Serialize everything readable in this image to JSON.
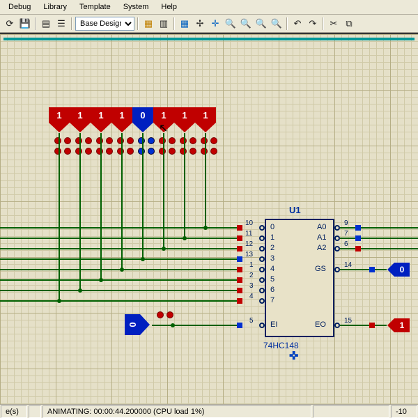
{
  "menu": {
    "items": [
      "Debug",
      "Library",
      "Template",
      "System",
      "Help"
    ]
  },
  "toolbar": {
    "design_dropdown": "Base Design"
  },
  "logic_inputs": {
    "top_row": [
      {
        "value": "1",
        "color": "red"
      },
      {
        "value": "1",
        "color": "red"
      },
      {
        "value": "1",
        "color": "red"
      },
      {
        "value": "1",
        "color": "red"
      },
      {
        "value": "0",
        "color": "blue"
      },
      {
        "value": "1",
        "color": "red"
      },
      {
        "value": "1",
        "color": "red"
      },
      {
        "value": "1",
        "color": "red"
      }
    ],
    "ei": {
      "value": "0",
      "color": "blue"
    }
  },
  "chip": {
    "ref": "U1",
    "part": "74HC148",
    "left_pins": [
      {
        "num": "10",
        "label": "0"
      },
      {
        "num": "11",
        "label": "1"
      },
      {
        "num": "12",
        "label": "2"
      },
      {
        "num": "13",
        "label": "3"
      },
      {
        "num": "1",
        "label": "4"
      },
      {
        "num": "2",
        "label": "5"
      },
      {
        "num": "3",
        "label": "6"
      },
      {
        "num": "4",
        "label": "7"
      },
      {
        "num": "5",
        "label": "EI"
      }
    ],
    "right_pins": [
      {
        "num": "9",
        "label": "A0"
      },
      {
        "num": "7",
        "label": "A1"
      },
      {
        "num": "6",
        "label": "A2"
      },
      {
        "num": "14",
        "label": "GS"
      },
      {
        "num": "15",
        "label": "EO"
      }
    ]
  },
  "outputs": {
    "gs": {
      "value": "0",
      "color": "blue"
    },
    "eo": {
      "value": "1",
      "color": "red"
    }
  },
  "status": {
    "left": "e(s)",
    "anim": "ANIMATING: 00:00:44.200000 (CPU load 1%)",
    "right": "-10"
  }
}
